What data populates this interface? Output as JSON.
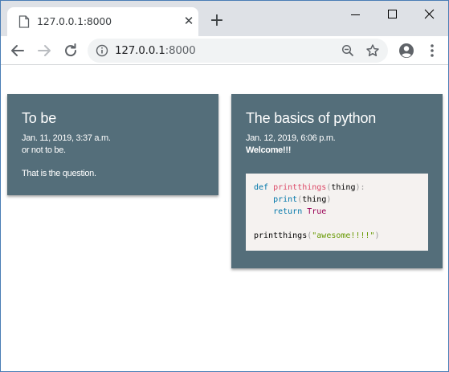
{
  "browser": {
    "tab": {
      "title": "127.0.0.1:8000"
    },
    "url": {
      "host": "127.0.0.1",
      "port": ":8000"
    }
  },
  "posts": [
    {
      "title": "To be",
      "date": "Jan. 11, 2019, 3:37 a.m.",
      "lines": [
        "or not to be.",
        "That is the question."
      ]
    },
    {
      "title": "The basics of python",
      "date": "Jan. 12, 2019, 6:06 p.m.",
      "bold_text": "Welcome!!!",
      "code": {
        "line1": {
          "kw": "def",
          "fn": "printthings",
          "open": "(",
          "arg": "thing",
          "close": "):"
        },
        "line2": {
          "fn": "print",
          "open": "(",
          "arg": "thing",
          "close": ")"
        },
        "line3": {
          "kw": "return",
          "val": "True"
        },
        "line5": {
          "fn": "printthings",
          "open": "(",
          "str": "\"awesome!!!!\"",
          "close": ")"
        }
      }
    }
  ]
}
